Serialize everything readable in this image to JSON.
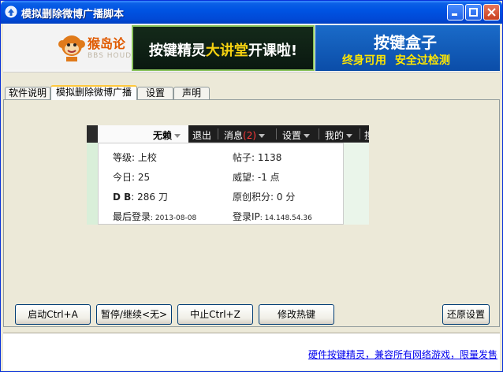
{
  "window": {
    "title": "模拟删除微博广播脚本"
  },
  "banner": {
    "logo_text": "猴岛论",
    "logo_sub": "BBS HOUDAO",
    "ad_part1": "按键精灵",
    "ad_highlight": "大讲堂",
    "ad_part2": "开课啦!",
    "box_title": "按键盒子",
    "box_sub": "终身可用 安全过检测"
  },
  "tabs": [
    {
      "label": "软件说明"
    },
    {
      "label": "模拟删除微博广播"
    },
    {
      "label": "设置"
    },
    {
      "label": "声明"
    }
  ],
  "screenshot": {
    "nav": {
      "user": "无赖",
      "logout": "退出",
      "messages": "消息",
      "message_count": "(2)",
      "settings": "设置",
      "mine": "我的",
      "more": "搜"
    },
    "rows": [
      {
        "left_label": "等级",
        "left_value": ": 上校",
        "right_label": "帖子",
        "right_value": ": 1138"
      },
      {
        "left_label": "今日",
        "left_value": ": 25",
        "right_label": "威望",
        "right_value": ": -1 点"
      },
      {
        "left_label": "D B",
        "left_value": ": 286 刀",
        "right_label": "原创积分",
        "right_value": ": 0 分"
      },
      {
        "left_label": "最后登录",
        "left_value": ": 2013-08-08",
        "right_label": "登录IP",
        "right_value": ": 14.148.54.36"
      }
    ]
  },
  "buttons": {
    "start": "启动Ctrl+A",
    "pause": "暂停/继续<无>",
    "stop": "中止Ctrl+Z",
    "hotkey": "修改热键",
    "reset": "还原设置"
  },
  "status": {
    "link": "硬件按键精灵，兼容所有网络游戏，限量发售"
  },
  "colors": {
    "titlebar": "#0054e3",
    "accent_tab": "#ffc83c",
    "link": "#0000ee"
  }
}
